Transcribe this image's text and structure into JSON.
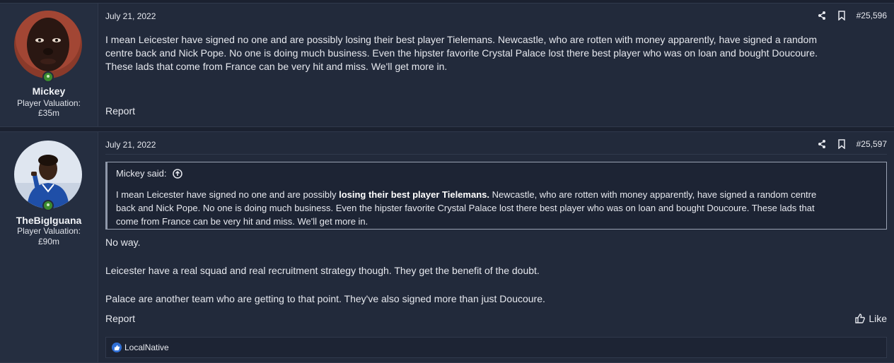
{
  "posts": [
    {
      "username": "Mickey",
      "valuation_label": "Player Valuation:",
      "valuation": "£35m",
      "date": "July 21, 2022",
      "post_number": "#25,596",
      "lines": [
        "I mean Leicester have signed no one and are possibly losing their best player Tielemans. Newcastle, who are rotten with money apparently, have signed a random",
        "centre back and Nick Pope. No one is doing much business. Even the hipster favorite Crystal Palace lost there best player who was on loan and bought Doucoure.",
        "These lads that come from France can be very hit and miss. We'll get more in."
      ],
      "report": "Report"
    },
    {
      "username": "TheBigIguana",
      "valuation_label": "Player Valuation:",
      "valuation": "£90m",
      "date": "July 21, 2022",
      "post_number": "#25,597",
      "quote": {
        "author": "Mickey said:",
        "line1_pre": "I mean Leicester have signed no one and are possibly ",
        "line1_bold": "losing their best player Tielemans.",
        "line1_post": " Newcastle, who are rotten with money apparently, have signed a random centre",
        "line2": "back and Nick Pope. No one is doing much business. Even the hipster favorite Crystal Palace lost there best player who was on loan and bought Doucoure. These lads that",
        "line3": "come from France can be very hit and miss. We'll get more in."
      },
      "paragraphs": [
        "No way.",
        "Leicester have a real squad and real recruitment strategy though. They get the benefit of the doubt.",
        "Palace are another team who are getting to that point. They've also signed more than just Doucoure."
      ],
      "report": "Report",
      "like": "Like",
      "reaction_user": "LocalNative"
    }
  ],
  "colors": {
    "background": "#1b2130",
    "post_bg": "#222a3b",
    "online": "#3c8d2f",
    "reaction_blue": "#2f6fd6"
  }
}
